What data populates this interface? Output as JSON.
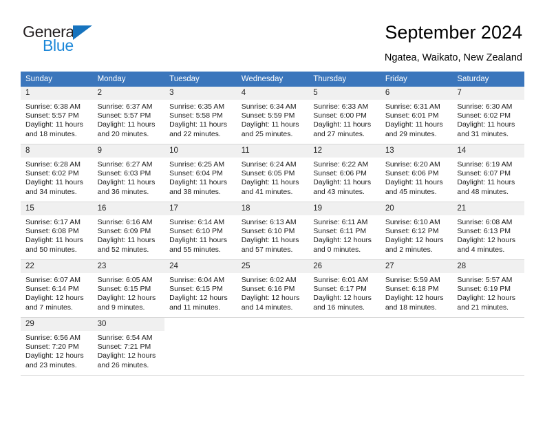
{
  "brand": {
    "name_top": "General",
    "name_bottom": "Blue",
    "accent_color": "#1c87d8",
    "triangle_color": "#1673be"
  },
  "header": {
    "title": "September 2024",
    "location": "Ngatea, Waikato, New Zealand"
  },
  "calendar": {
    "header_bg": "#3b76bc",
    "daynum_bg": "#f0f0f0",
    "weekdays": [
      "Sunday",
      "Monday",
      "Tuesday",
      "Wednesday",
      "Thursday",
      "Friday",
      "Saturday"
    ],
    "weeks": [
      [
        {
          "day": "1",
          "sunrise": "Sunrise: 6:38 AM",
          "sunset": "Sunset: 5:57 PM",
          "daylight_1": "Daylight: 11 hours",
          "daylight_2": "and 18 minutes."
        },
        {
          "day": "2",
          "sunrise": "Sunrise: 6:37 AM",
          "sunset": "Sunset: 5:57 PM",
          "daylight_1": "Daylight: 11 hours",
          "daylight_2": "and 20 minutes."
        },
        {
          "day": "3",
          "sunrise": "Sunrise: 6:35 AM",
          "sunset": "Sunset: 5:58 PM",
          "daylight_1": "Daylight: 11 hours",
          "daylight_2": "and 22 minutes."
        },
        {
          "day": "4",
          "sunrise": "Sunrise: 6:34 AM",
          "sunset": "Sunset: 5:59 PM",
          "daylight_1": "Daylight: 11 hours",
          "daylight_2": "and 25 minutes."
        },
        {
          "day": "5",
          "sunrise": "Sunrise: 6:33 AM",
          "sunset": "Sunset: 6:00 PM",
          "daylight_1": "Daylight: 11 hours",
          "daylight_2": "and 27 minutes."
        },
        {
          "day": "6",
          "sunrise": "Sunrise: 6:31 AM",
          "sunset": "Sunset: 6:01 PM",
          "daylight_1": "Daylight: 11 hours",
          "daylight_2": "and 29 minutes."
        },
        {
          "day": "7",
          "sunrise": "Sunrise: 6:30 AM",
          "sunset": "Sunset: 6:02 PM",
          "daylight_1": "Daylight: 11 hours",
          "daylight_2": "and 31 minutes."
        }
      ],
      [
        {
          "day": "8",
          "sunrise": "Sunrise: 6:28 AM",
          "sunset": "Sunset: 6:02 PM",
          "daylight_1": "Daylight: 11 hours",
          "daylight_2": "and 34 minutes."
        },
        {
          "day": "9",
          "sunrise": "Sunrise: 6:27 AM",
          "sunset": "Sunset: 6:03 PM",
          "daylight_1": "Daylight: 11 hours",
          "daylight_2": "and 36 minutes."
        },
        {
          "day": "10",
          "sunrise": "Sunrise: 6:25 AM",
          "sunset": "Sunset: 6:04 PM",
          "daylight_1": "Daylight: 11 hours",
          "daylight_2": "and 38 minutes."
        },
        {
          "day": "11",
          "sunrise": "Sunrise: 6:24 AM",
          "sunset": "Sunset: 6:05 PM",
          "daylight_1": "Daylight: 11 hours",
          "daylight_2": "and 41 minutes."
        },
        {
          "day": "12",
          "sunrise": "Sunrise: 6:22 AM",
          "sunset": "Sunset: 6:06 PM",
          "daylight_1": "Daylight: 11 hours",
          "daylight_2": "and 43 minutes."
        },
        {
          "day": "13",
          "sunrise": "Sunrise: 6:20 AM",
          "sunset": "Sunset: 6:06 PM",
          "daylight_1": "Daylight: 11 hours",
          "daylight_2": "and 45 minutes."
        },
        {
          "day": "14",
          "sunrise": "Sunrise: 6:19 AM",
          "sunset": "Sunset: 6:07 PM",
          "daylight_1": "Daylight: 11 hours",
          "daylight_2": "and 48 minutes."
        }
      ],
      [
        {
          "day": "15",
          "sunrise": "Sunrise: 6:17 AM",
          "sunset": "Sunset: 6:08 PM",
          "daylight_1": "Daylight: 11 hours",
          "daylight_2": "and 50 minutes."
        },
        {
          "day": "16",
          "sunrise": "Sunrise: 6:16 AM",
          "sunset": "Sunset: 6:09 PM",
          "daylight_1": "Daylight: 11 hours",
          "daylight_2": "and 52 minutes."
        },
        {
          "day": "17",
          "sunrise": "Sunrise: 6:14 AM",
          "sunset": "Sunset: 6:10 PM",
          "daylight_1": "Daylight: 11 hours",
          "daylight_2": "and 55 minutes."
        },
        {
          "day": "18",
          "sunrise": "Sunrise: 6:13 AM",
          "sunset": "Sunset: 6:10 PM",
          "daylight_1": "Daylight: 11 hours",
          "daylight_2": "and 57 minutes."
        },
        {
          "day": "19",
          "sunrise": "Sunrise: 6:11 AM",
          "sunset": "Sunset: 6:11 PM",
          "daylight_1": "Daylight: 12 hours",
          "daylight_2": "and 0 minutes."
        },
        {
          "day": "20",
          "sunrise": "Sunrise: 6:10 AM",
          "sunset": "Sunset: 6:12 PM",
          "daylight_1": "Daylight: 12 hours",
          "daylight_2": "and 2 minutes."
        },
        {
          "day": "21",
          "sunrise": "Sunrise: 6:08 AM",
          "sunset": "Sunset: 6:13 PM",
          "daylight_1": "Daylight: 12 hours",
          "daylight_2": "and 4 minutes."
        }
      ],
      [
        {
          "day": "22",
          "sunrise": "Sunrise: 6:07 AM",
          "sunset": "Sunset: 6:14 PM",
          "daylight_1": "Daylight: 12 hours",
          "daylight_2": "and 7 minutes."
        },
        {
          "day": "23",
          "sunrise": "Sunrise: 6:05 AM",
          "sunset": "Sunset: 6:15 PM",
          "daylight_1": "Daylight: 12 hours",
          "daylight_2": "and 9 minutes."
        },
        {
          "day": "24",
          "sunrise": "Sunrise: 6:04 AM",
          "sunset": "Sunset: 6:15 PM",
          "daylight_1": "Daylight: 12 hours",
          "daylight_2": "and 11 minutes."
        },
        {
          "day": "25",
          "sunrise": "Sunrise: 6:02 AM",
          "sunset": "Sunset: 6:16 PM",
          "daylight_1": "Daylight: 12 hours",
          "daylight_2": "and 14 minutes."
        },
        {
          "day": "26",
          "sunrise": "Sunrise: 6:01 AM",
          "sunset": "Sunset: 6:17 PM",
          "daylight_1": "Daylight: 12 hours",
          "daylight_2": "and 16 minutes."
        },
        {
          "day": "27",
          "sunrise": "Sunrise: 5:59 AM",
          "sunset": "Sunset: 6:18 PM",
          "daylight_1": "Daylight: 12 hours",
          "daylight_2": "and 18 minutes."
        },
        {
          "day": "28",
          "sunrise": "Sunrise: 5:57 AM",
          "sunset": "Sunset: 6:19 PM",
          "daylight_1": "Daylight: 12 hours",
          "daylight_2": "and 21 minutes."
        }
      ],
      [
        {
          "day": "29",
          "sunrise": "Sunrise: 6:56 AM",
          "sunset": "Sunset: 7:20 PM",
          "daylight_1": "Daylight: 12 hours",
          "daylight_2": "and 23 minutes."
        },
        {
          "day": "30",
          "sunrise": "Sunrise: 6:54 AM",
          "sunset": "Sunset: 7:21 PM",
          "daylight_1": "Daylight: 12 hours",
          "daylight_2": "and 26 minutes."
        },
        {
          "day": "",
          "sunrise": "",
          "sunset": "",
          "daylight_1": "",
          "daylight_2": ""
        },
        {
          "day": "",
          "sunrise": "",
          "sunset": "",
          "daylight_1": "",
          "daylight_2": ""
        },
        {
          "day": "",
          "sunrise": "",
          "sunset": "",
          "daylight_1": "",
          "daylight_2": ""
        },
        {
          "day": "",
          "sunrise": "",
          "sunset": "",
          "daylight_1": "",
          "daylight_2": ""
        },
        {
          "day": "",
          "sunrise": "",
          "sunset": "",
          "daylight_1": "",
          "daylight_2": ""
        }
      ]
    ]
  }
}
